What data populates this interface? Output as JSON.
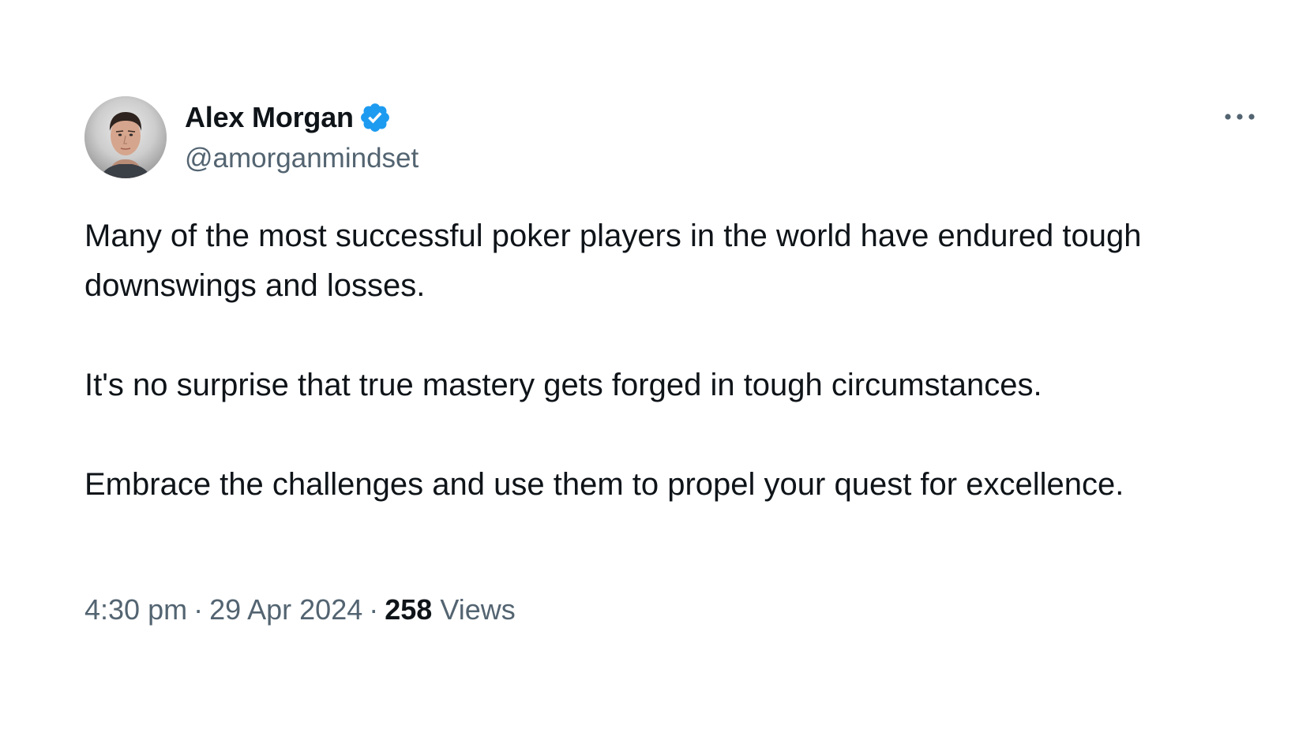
{
  "author": {
    "display_name": "Alex Morgan",
    "handle": "@amorganmindset",
    "verified": true,
    "verified_icon": "verified-badge-icon",
    "avatar_icon": "avatar-photo"
  },
  "more_menu": {
    "icon": "more-horizontal-icon"
  },
  "tweet": {
    "paragraphs": [
      "Many of the most successful poker players in the world have endured tough downswings and losses.",
      "It's no surprise that true mastery gets forged in tough circumstances.",
      "Embrace the challenges and use them to propel your quest for excellence."
    ],
    "time": "4:30 pm",
    "date": "29 Apr 2024",
    "separator": "·",
    "views_count": "258",
    "views_label": "Views"
  },
  "colors": {
    "primary_text": "#0f1419",
    "secondary_text": "#536471",
    "verified_blue": "#1d9bf0",
    "background": "#ffffff"
  }
}
